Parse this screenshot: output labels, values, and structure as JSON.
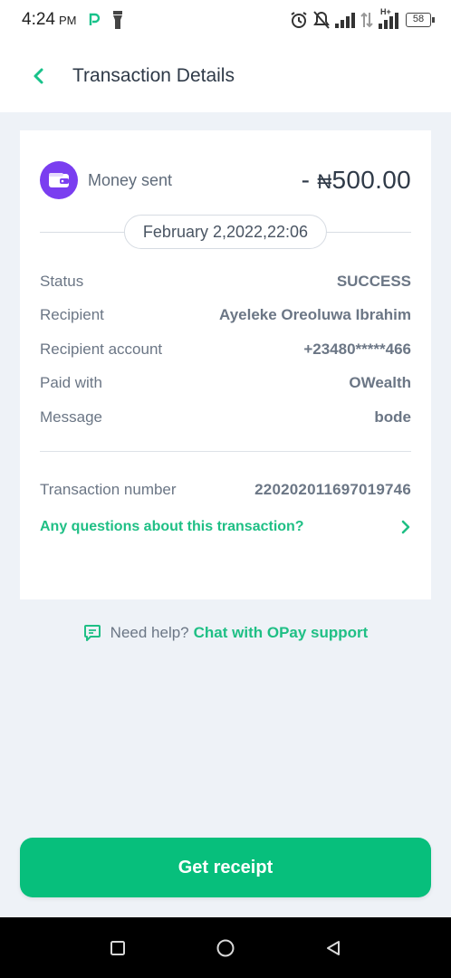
{
  "status_bar": {
    "time": "4:24",
    "ampm": "PM",
    "network_label": "H+",
    "battery": "58"
  },
  "header": {
    "title": "Transaction Details"
  },
  "transaction": {
    "type_label": "Money sent",
    "amount_sign": "- ",
    "currency_symbol": "₦",
    "amount": "500.00",
    "date": "February 2,2022,22:06",
    "details": [
      {
        "label": "Status",
        "value": "SUCCESS"
      },
      {
        "label": "Recipient",
        "value": "Ayeleke Oreoluwa Ibrahim"
      },
      {
        "label": "Recipient account",
        "value": "+23480*****466"
      },
      {
        "label": "Paid with",
        "value": "OWealth"
      },
      {
        "label": "Message",
        "value": "bode"
      }
    ],
    "number_label": "Transaction number",
    "number_value": "220202011697019746",
    "questions_link": "Any questions about this transaction?"
  },
  "help": {
    "prefix": "Need help?",
    "link": "Chat with OPay support"
  },
  "actions": {
    "receipt_label": "Get receipt"
  },
  "colors": {
    "accent": "#07bf7c",
    "link": "#1fbf85",
    "wallet_icon_bg": "#7a3ef0",
    "background": "#eef2f7"
  },
  "icons": {
    "back": "chevron-left-icon",
    "wallet": "wallet-icon",
    "chevron_right": "chevron-right-icon",
    "chat": "chat-bubble-icon"
  }
}
